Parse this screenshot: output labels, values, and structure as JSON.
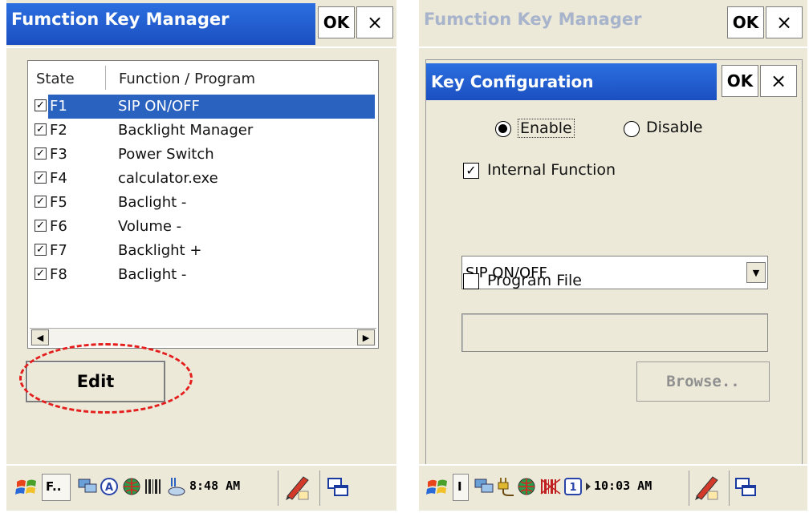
{
  "left_screen": {
    "title": "Fumction Key Manager",
    "ok_label": "OK",
    "close_label": "×",
    "columns": [
      "State",
      "Function / Program"
    ],
    "rows": [
      {
        "key": "F1",
        "program": "SIP ON/OFF",
        "checked": true,
        "selected": true
      },
      {
        "key": "F2",
        "program": "Backlight Manager",
        "checked": true,
        "selected": false
      },
      {
        "key": "F3",
        "program": "Power Switch",
        "checked": true,
        "selected": false
      },
      {
        "key": "F4",
        "program": "calculator.exe",
        "checked": true,
        "selected": false
      },
      {
        "key": "F5",
        "program": "Baclight -",
        "checked": true,
        "selected": false
      },
      {
        "key": "F6",
        "program": "Volume -",
        "checked": true,
        "selected": false
      },
      {
        "key": "F7",
        "program": "Backlight +",
        "checked": true,
        "selected": false
      },
      {
        "key": "F8",
        "program": "Baclight -",
        "checked": true,
        "selected": false
      }
    ],
    "edit_label": "Edit",
    "taskbar": {
      "app_label": "F..",
      "clock": "8:48 AM"
    }
  },
  "right_screen": {
    "background_title": "Fumction Key Manager",
    "ok_label": "OK",
    "close_label": "×",
    "dialog": {
      "title": "Key Configuration",
      "ok_label": "OK",
      "close_label": "×",
      "enable_label": "Enable",
      "disable_label": "Disable",
      "enabled": true,
      "internal_function_label": "Internal Function",
      "internal_function_checked": true,
      "function_value": "SIP ON/OFF",
      "program_file_label": "Program File",
      "program_file_checked": false,
      "program_file_value": "",
      "browse_label": "Browse.."
    },
    "taskbar": {
      "app_label": "I",
      "clock": "10:03 AM"
    }
  },
  "colors": {
    "title_blue": "#1b4fc0",
    "selection": "#2a62c0",
    "highlight_ring": "#e41d1d",
    "panel": "#ece9d8"
  }
}
